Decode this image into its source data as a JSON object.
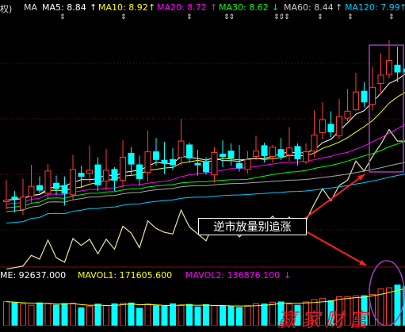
{
  "ma_legend": {
    "ma5": "MA5: 8.84",
    "ma10": "MA10: 8.92",
    "ma20": "MA20: 8.72",
    "ma30": "MA30: 8.62",
    "ma60": "MA60: 8.44",
    "ma120": "MA120: 7.99",
    "ma_tag": "MA",
    "left_fragment": "权)"
  },
  "vol_legend": {
    "vol": "ME: 92637.000",
    "mavol1": "MAVOL1: 171605.600",
    "mavol2": "MAVOL2: 136876.100"
  },
  "annotation": "逆市放量别追涨",
  "watermark": "赢家财富",
  "colors": {
    "up": "#ff3a3a",
    "down": "#00ffff",
    "ma5": "#ffffff",
    "ma10": "#ffff00",
    "ma20": "#ff00ff",
    "ma30": "#00ff00",
    "ma60": "#aaaaaa",
    "ma120": "#00ccff",
    "long": "#e6e6a0",
    "grid": "#7a1010",
    "highlight": "#a040c0",
    "arrow": "#ff2020"
  },
  "chart_data": {
    "type": "candlestick",
    "indicators": [
      "MA5",
      "MA10",
      "MA20",
      "MA30",
      "MA60",
      "MA120",
      "MAVOL1",
      "MAVOL2"
    ],
    "price_candles": [
      {
        "o": 8.08,
        "c": 8.1,
        "h": 8.36,
        "l": 7.98
      },
      {
        "o": 8.14,
        "c": 8.12,
        "h": 8.22,
        "l": 7.94
      },
      {
        "o": 7.98,
        "c": 8.14,
        "h": 8.38,
        "l": 7.91
      },
      {
        "o": 8.15,
        "c": 8.28,
        "h": 8.56,
        "l": 8.07
      },
      {
        "o": 8.29,
        "c": 8.23,
        "h": 8.41,
        "l": 8.19
      },
      {
        "o": 8.19,
        "c": 8.48,
        "h": 8.57,
        "l": 8.11
      },
      {
        "o": 8.32,
        "c": 8.25,
        "h": 8.42,
        "l": 8.16
      },
      {
        "o": 8.29,
        "c": 8.19,
        "h": 8.41,
        "l": 8.03
      },
      {
        "o": 8.17,
        "c": 8.5,
        "h": 8.69,
        "l": 8.1
      },
      {
        "o": 8.45,
        "c": 8.41,
        "h": 8.55,
        "l": 8.26
      },
      {
        "o": 8.45,
        "c": 8.49,
        "h": 8.81,
        "l": 8.33
      },
      {
        "o": 8.56,
        "c": 8.3,
        "h": 8.66,
        "l": 8.22
      },
      {
        "o": 8.35,
        "c": 8.49,
        "h": 8.77,
        "l": 8.23
      },
      {
        "o": 8.5,
        "c": 8.36,
        "h": 8.53,
        "l": 8.22
      },
      {
        "o": 8.36,
        "c": 8.66,
        "h": 8.88,
        "l": 8.26
      },
      {
        "o": 8.71,
        "c": 8.57,
        "h": 8.79,
        "l": 8.43
      },
      {
        "o": 8.56,
        "c": 8.38,
        "h": 8.68,
        "l": 8.29
      },
      {
        "o": 8.46,
        "c": 8.73,
        "h": 9.01,
        "l": 8.34
      },
      {
        "o": 8.73,
        "c": 8.63,
        "h": 8.91,
        "l": 8.55
      },
      {
        "o": 8.62,
        "c": 8.58,
        "h": 8.86,
        "l": 8.44
      },
      {
        "o": 8.63,
        "c": 8.56,
        "h": 8.78,
        "l": 8.49
      },
      {
        "o": 8.66,
        "c": 8.87,
        "h": 9.16,
        "l": 8.55
      },
      {
        "o": 8.82,
        "c": 8.65,
        "h": 8.85,
        "l": 8.59
      },
      {
        "o": 8.58,
        "c": 8.56,
        "h": 8.76,
        "l": 8.42
      },
      {
        "o": 8.6,
        "c": 8.47,
        "h": 8.66,
        "l": 8.43
      },
      {
        "o": 8.43,
        "c": 8.72,
        "h": 8.79,
        "l": 8.33
      },
      {
        "o": 8.7,
        "c": 8.67,
        "h": 8.88,
        "l": 8.53
      },
      {
        "o": 8.74,
        "c": 8.65,
        "h": 8.84,
        "l": 8.55
      },
      {
        "o": 8.58,
        "c": 8.52,
        "h": 8.82,
        "l": 8.47
      },
      {
        "o": 8.5,
        "c": 8.63,
        "h": 8.74,
        "l": 8.45
      },
      {
        "o": 8.67,
        "c": 8.74,
        "h": 8.94,
        "l": 8.62
      },
      {
        "o": 8.81,
        "c": 8.68,
        "h": 8.85,
        "l": 8.59
      },
      {
        "o": 8.67,
        "c": 8.79,
        "h": 8.82,
        "l": 8.59
      },
      {
        "o": 8.76,
        "c": 8.67,
        "h": 8.91,
        "l": 8.62
      },
      {
        "o": 8.69,
        "c": 8.78,
        "h": 9.05,
        "l": 8.61
      },
      {
        "o": 8.8,
        "c": 8.64,
        "h": 8.84,
        "l": 8.55
      },
      {
        "o": 8.6,
        "c": 8.73,
        "h": 8.84,
        "l": 8.57
      },
      {
        "o": 8.74,
        "c": 8.95,
        "h": 9.27,
        "l": 8.66
      },
      {
        "o": 8.98,
        "c": 9.15,
        "h": 9.38,
        "l": 8.89
      },
      {
        "o": 9.09,
        "c": 8.99,
        "h": 9.26,
        "l": 8.92
      },
      {
        "o": 8.94,
        "c": 9.19,
        "h": 9.42,
        "l": 8.9
      },
      {
        "o": 9.17,
        "c": 9.26,
        "h": 9.55,
        "l": 9.13
      },
      {
        "o": 9.28,
        "c": 9.51,
        "h": 9.76,
        "l": 9.26
      },
      {
        "o": 9.52,
        "c": 9.38,
        "h": 9.64,
        "l": 9.31
      },
      {
        "o": 9.35,
        "c": 9.57,
        "h": 9.84,
        "l": 9.27
      },
      {
        "o": 9.62,
        "c": 9.73,
        "h": 10.01,
        "l": 9.48
      },
      {
        "o": 9.74,
        "c": 9.92,
        "h": 10.19,
        "l": 9.69
      },
      {
        "o": 9.86,
        "c": 9.77,
        "h": 10.1,
        "l": 9.64
      },
      {
        "o": 9.81,
        "c": 9.77,
        "h": 10.04,
        "l": 9.64
      }
    ],
    "volume_bars": [
      {
        "v": 172000,
        "up": true
      },
      {
        "v": 165000,
        "up": false
      },
      {
        "v": 155000,
        "up": true
      },
      {
        "v": 146000,
        "up": true
      },
      {
        "v": 163000,
        "up": false
      },
      {
        "v": 160000,
        "up": true
      },
      {
        "v": 147000,
        "up": false
      },
      {
        "v": 158000,
        "up": false
      },
      {
        "v": 160000,
        "up": true
      },
      {
        "v": 127000,
        "up": false
      },
      {
        "v": 138000,
        "up": true
      },
      {
        "v": 154000,
        "up": false
      },
      {
        "v": 144000,
        "up": true
      },
      {
        "v": 156000,
        "up": false
      },
      {
        "v": 161000,
        "up": true
      },
      {
        "v": 162000,
        "up": false
      },
      {
        "v": 124000,
        "up": false
      },
      {
        "v": 155000,
        "up": true
      },
      {
        "v": 143000,
        "up": false
      },
      {
        "v": 140000,
        "up": false
      },
      {
        "v": 156000,
        "up": false
      },
      {
        "v": 144000,
        "up": true
      },
      {
        "v": 152000,
        "up": false
      },
      {
        "v": 134000,
        "up": false
      },
      {
        "v": 150000,
        "up": false
      },
      {
        "v": 143000,
        "up": true
      },
      {
        "v": 142000,
        "up": false
      },
      {
        "v": 139000,
        "up": false
      },
      {
        "v": 130000,
        "up": false
      },
      {
        "v": 144000,
        "up": true
      },
      {
        "v": 157000,
        "up": true
      },
      {
        "v": 155000,
        "up": false
      },
      {
        "v": 168000,
        "up": true
      },
      {
        "v": 170000,
        "up": false
      },
      {
        "v": 155000,
        "up": true
      },
      {
        "v": 146000,
        "up": false
      },
      {
        "v": 170000,
        "up": true
      },
      {
        "v": 186000,
        "up": true
      },
      {
        "v": 196000,
        "up": true
      },
      {
        "v": 178000,
        "up": false
      },
      {
        "v": 206000,
        "up": true
      },
      {
        "v": 208000,
        "up": true
      },
      {
        "v": 213000,
        "up": true
      },
      {
        "v": 214000,
        "up": false
      },
      {
        "v": 224000,
        "up": true
      },
      {
        "v": 262000,
        "up": true
      },
      {
        "v": 271000,
        "up": true
      },
      {
        "v": 290000,
        "up": false
      },
      {
        "v": 279000,
        "up": false
      }
    ]
  }
}
